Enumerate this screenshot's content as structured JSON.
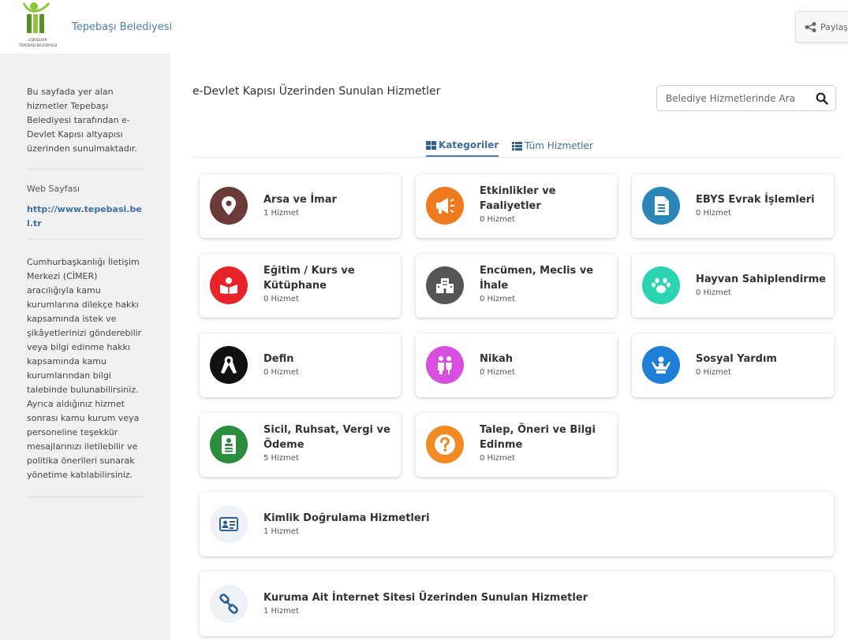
{
  "header": {
    "logo_alt": "ESKİŞEHİR TEPEBAŞI BELEDİYESİ",
    "org_name": "Tepebaşı Belediyesi",
    "share_label": "Paylaş"
  },
  "sidebar": {
    "intro": "Bu sayfada yer alan hizmetler Tepebaşı Belediyesi tarafından e-Devlet Kapısı altyapısı üzerinden sunulmaktadır.",
    "web_label": "Web Sayfası",
    "web_url": "http://www.tepebasi.bel.tr",
    "cimer_text": "Cumhurbaşkanlığı İletişim Merkezi (CİMER) aracılığıyla kamu kurumlarına dilekçe hakkı kapsamında istek ve şikâyetlerinizi gönderebilir veya bilgi edinme hakkı kapsamında kamu kurumlarından bilgi talebinde bulunabilirsiniz. Ayrıca aldığınız hizmet sonrası kamu kurum veya personeline teşekkür mesajlarınızı iletilebilir ve politika önerileri sunarak yönetime katılabilirsiniz."
  },
  "main": {
    "title": "e-Devlet Kapısı Üzerinden Sunulan Hizmetler",
    "search_placeholder": "Belediye Hizmetlerinde Ara",
    "tabs": [
      {
        "label": "Kategoriler",
        "icon": "grid-icon"
      },
      {
        "label": "Tüm Hizmetler",
        "icon": "list-icon"
      }
    ],
    "categories": [
      {
        "title": "Arsa ve İmar",
        "count": "1 Hizmet",
        "icon": "map-marker-icon",
        "color": "#6b3b37"
      },
      {
        "title": "Etkinlikler ve Faaliyetler",
        "count": "0 Hizmet",
        "icon": "megaphone-icon",
        "color": "#f07a1e"
      },
      {
        "title": "EBYS Evrak İşlemleri",
        "count": "0 Hizmet",
        "icon": "document-icon",
        "color": "#2a86b8"
      },
      {
        "title": "Eğitim / Kurs ve Kütüphane",
        "count": "0 Hizmet",
        "icon": "book-reader-icon",
        "color": "#e8232a"
      },
      {
        "title": "Encümen, Meclis ve İhale",
        "count": "0 Hizmet",
        "icon": "building-icon",
        "color": "#555555"
      },
      {
        "title": "Hayvan Sahiplendirme",
        "count": "0 Hizmet",
        "icon": "paw-icon",
        "color": "#2bd4b0"
      },
      {
        "title": "Defin",
        "count": "0 Hizmet",
        "icon": "ribbon-icon",
        "color": "#111111"
      },
      {
        "title": "Nikah",
        "count": "0 Hizmet",
        "icon": "couple-icon",
        "color": "#d84fe0"
      },
      {
        "title": "Sosyal Yardım",
        "count": "0 Hizmet",
        "icon": "helping-hands-icon",
        "color": "#1e7fd8"
      },
      {
        "title": "Sicil, Ruhsat, Vergi ve Ödeme",
        "count": "5 Hizmet",
        "icon": "id-file-icon",
        "color": "#2b8c3c"
      },
      {
        "title": "Talep, Öneri ve Bilgi Edinme",
        "count": "0 Hizmet",
        "icon": "question-icon",
        "color": "#f08a22"
      },
      {
        "title": "Kimlik Doğrulama Hizmetleri",
        "count": "1 Hizmet",
        "icon": "id-card-icon",
        "color": "#eef1f5"
      },
      {
        "title": "Kuruma Ait İnternet Sitesi Üzerinden Sunulan Hizmetler",
        "count": "1 Hizmet",
        "icon": "link-icon",
        "color": "#eef1f5"
      }
    ]
  }
}
